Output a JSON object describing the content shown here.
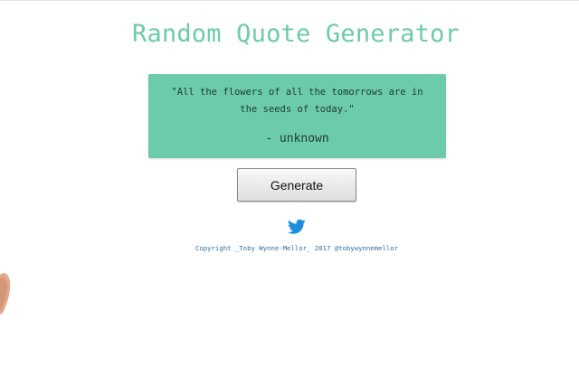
{
  "header": {
    "title": "Random Quote Generator"
  },
  "quote": {
    "text": "\"All the flowers of all the tomorrows are in the seeds of today.\"",
    "author": "- unknown"
  },
  "actions": {
    "generate_label": "Generate"
  },
  "footer": {
    "twitter_icon": "twitter-bird-icon",
    "copyright": "Copyright _Toby Wynne-Mellor_ 2017 @tobywynnemellor"
  },
  "colors": {
    "accent": "#6ccbab",
    "twitter_blue": "#1d8fe0",
    "link": "#2c6ea8"
  }
}
